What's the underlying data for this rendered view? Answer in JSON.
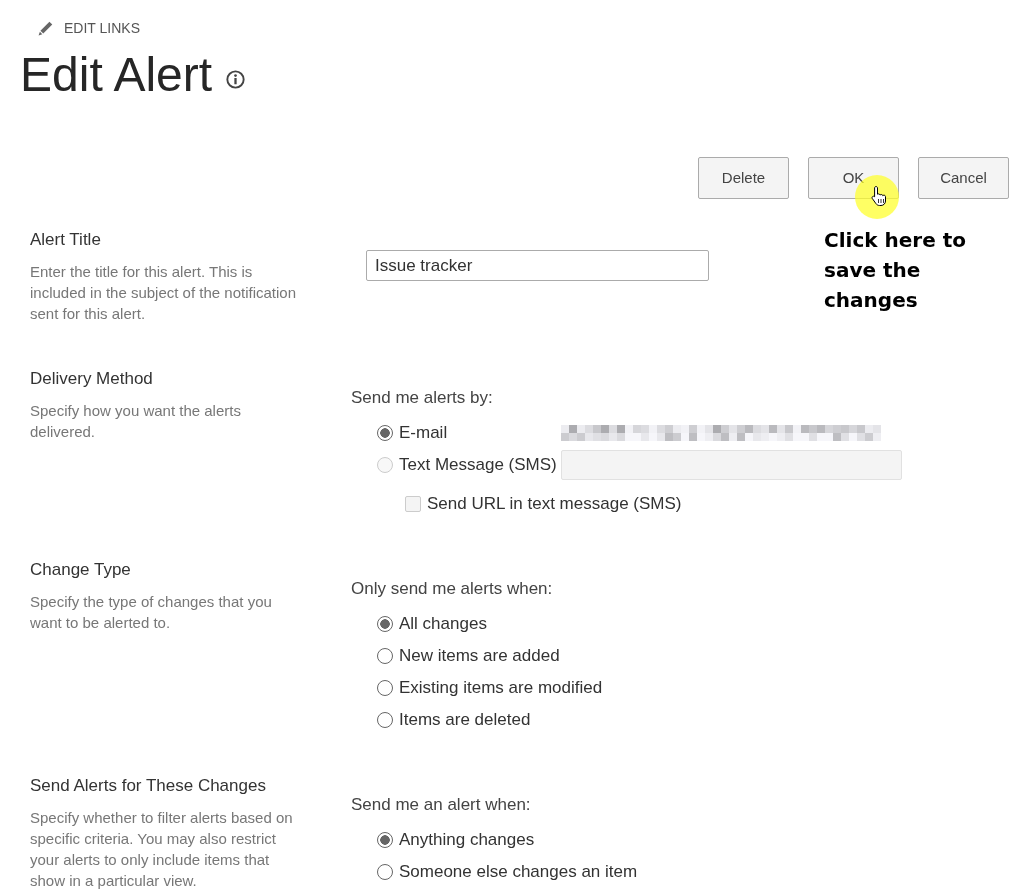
{
  "header": {
    "edit_links": "EDIT LINKS",
    "title": "Edit Alert"
  },
  "buttons": [
    {
      "label": "Delete"
    },
    {
      "label": "OK"
    },
    {
      "label": "Cancel"
    }
  ],
  "annotation": {
    "text": "Click here to save the changes"
  },
  "sections": [
    {
      "kind": "text_field",
      "title": "Alert Title",
      "description": "Enter the title for this alert. This is included in the subject of the notification sent for this alert.",
      "field": {
        "value": "Issue tracker"
      }
    },
    {
      "kind": "delivery",
      "title": "Delivery Method",
      "description": "Specify how you want the alerts delivered.",
      "prompt": "Send me alerts by:",
      "options": [
        {
          "kind": "email",
          "label": "E-mail",
          "selected": true,
          "disabled": false
        },
        {
          "kind": "sms",
          "label": "Text Message (SMS)",
          "selected": false,
          "disabled": true
        }
      ],
      "sms_url_option": {
        "label": "Send URL in text message (SMS)",
        "checked": false,
        "disabled": true
      }
    },
    {
      "kind": "choice",
      "title": "Change Type",
      "description": "Specify the type of changes that you want to be alerted to.",
      "prompt": "Only send me alerts when:",
      "options": [
        {
          "label": "All changes",
          "selected": true
        },
        {
          "label": "New items are added",
          "selected": false
        },
        {
          "label": "Existing items are modified",
          "selected": false
        },
        {
          "label": "Items are deleted",
          "selected": false
        }
      ]
    },
    {
      "kind": "choice",
      "title": "Send Alerts for These Changes",
      "description": "Specify whether to filter alerts based on specific criteria. You may also restrict your alerts to only include items that show in a particular view.",
      "prompt": "Send me an alert when:",
      "options": [
        {
          "label": "Anything changes",
          "selected": true
        },
        {
          "label": "Someone else changes an item",
          "selected": false
        }
      ]
    }
  ]
}
